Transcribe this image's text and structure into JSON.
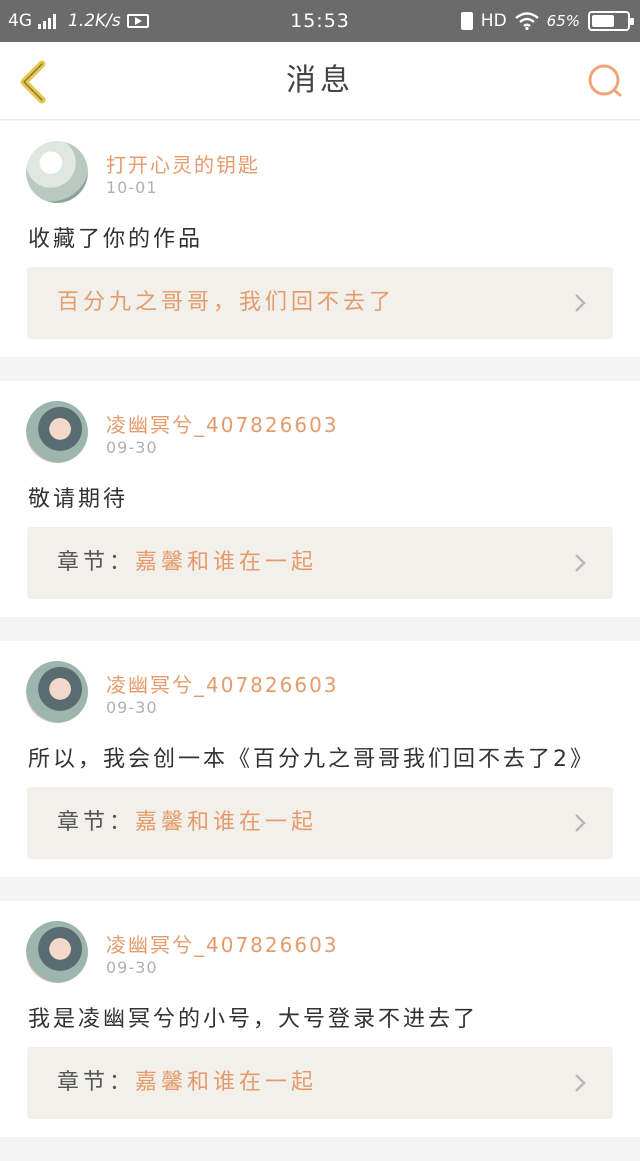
{
  "status_bar": {
    "network": "4G",
    "speed": "1.2K/s",
    "time": "15:53",
    "hd": "HD",
    "battery_pct": "65%",
    "battery_level": 0.65
  },
  "header": {
    "title": "消息"
  },
  "colors": {
    "accent": "#e59b6b",
    "back": "#e8c84a",
    "status_bar": "#6b6b6b"
  },
  "messages": [
    {
      "user": "打开心灵的钥匙",
      "time": "10-01",
      "text": "收藏了你的作品",
      "ref_prefix": "",
      "ref_title": "百分九之哥哥，我们回不去了"
    },
    {
      "user": "凌幽冥兮_407826603",
      "time": "09-30",
      "text": "敬请期待",
      "ref_prefix": "章节：",
      "ref_title": "嘉馨和谁在一起"
    },
    {
      "user": "凌幽冥兮_407826603",
      "time": "09-30",
      "text": "所以，我会创一本《百分九之哥哥我们回不去了2》",
      "ref_prefix": "章节：",
      "ref_title": "嘉馨和谁在一起"
    },
    {
      "user": "凌幽冥兮_407826603",
      "time": "09-30",
      "text": "我是凌幽冥兮的小号，大号登录不进去了",
      "ref_prefix": "章节：",
      "ref_title": "嘉馨和谁在一起"
    }
  ]
}
